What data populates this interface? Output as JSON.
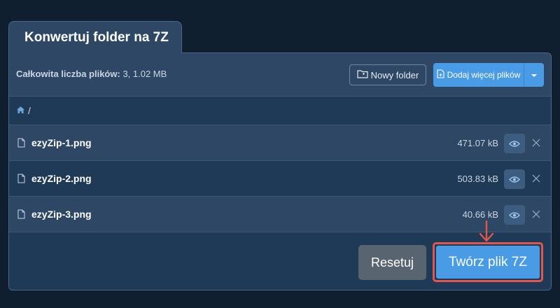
{
  "title": "Konwertuj folder na 7Z",
  "summary": {
    "label": "Całkowita liczba plików:",
    "value": "3, 1.02 MB"
  },
  "toolbar": {
    "new_folder_label": "Nowy folder",
    "add_files_label": "Dodaj więcej plików"
  },
  "breadcrumb": {
    "separator": "/"
  },
  "files": [
    {
      "name": "ezyZip-1.png",
      "size": "471.07 kB"
    },
    {
      "name": "ezyZip-2.png",
      "size": "503.83 kB"
    },
    {
      "name": "ezyZip-3.png",
      "size": "40.66 kB"
    }
  ],
  "actions": {
    "reset_label": "Resetuj",
    "create_label": "Twórz plik 7Z"
  },
  "colors": {
    "accent": "#4a9be6",
    "highlight": "#e2564c",
    "background": "#0f1f30"
  }
}
